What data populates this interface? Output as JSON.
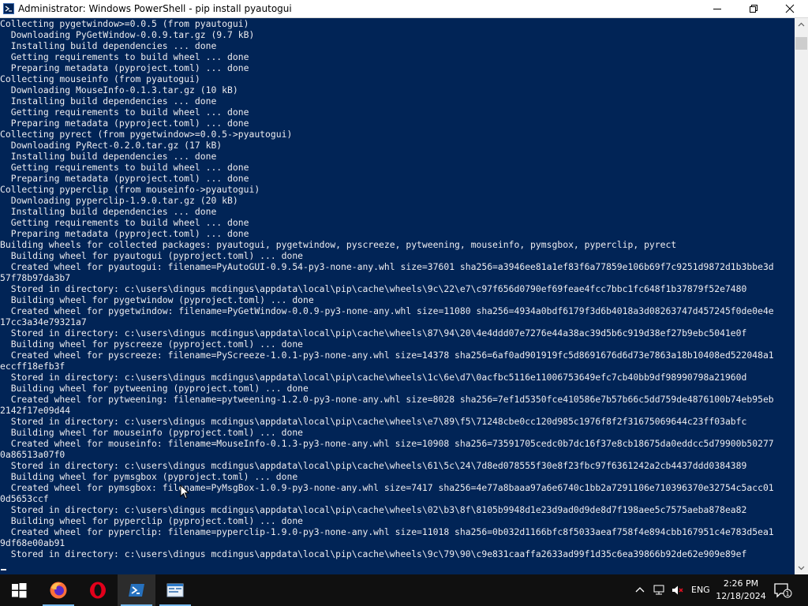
{
  "window": {
    "title": "Administrator: Windows PowerShell - pip  install pyautogui"
  },
  "console": {
    "lines": [
      "Collecting pygetwindow>=0.0.5 (from pyautogui)",
      "  Downloading PyGetWindow-0.0.9.tar.gz (9.7 kB)",
      "  Installing build dependencies ... done",
      "  Getting requirements to build wheel ... done",
      "  Preparing metadata (pyproject.toml) ... done",
      "Collecting mouseinfo (from pyautogui)",
      "  Downloading MouseInfo-0.1.3.tar.gz (10 kB)",
      "  Installing build dependencies ... done",
      "  Getting requirements to build wheel ... done",
      "  Preparing metadata (pyproject.toml) ... done",
      "Collecting pyrect (from pygetwindow>=0.0.5->pyautogui)",
      "  Downloading PyRect-0.2.0.tar.gz (17 kB)",
      "  Installing build dependencies ... done",
      "  Getting requirements to build wheel ... done",
      "  Preparing metadata (pyproject.toml) ... done",
      "Collecting pyperclip (from mouseinfo->pyautogui)",
      "  Downloading pyperclip-1.9.0.tar.gz (20 kB)",
      "  Installing build dependencies ... done",
      "  Getting requirements to build wheel ... done",
      "  Preparing metadata (pyproject.toml) ... done",
      "Building wheels for collected packages: pyautogui, pygetwindow, pyscreeze, pytweening, mouseinfo, pymsgbox, pyperclip, pyrect",
      "  Building wheel for pyautogui (pyproject.toml) ... done",
      "  Created wheel for pyautogui: filename=PyAutoGUI-0.9.54-py3-none-any.whl size=37601 sha256=a3946ee81a1ef83f6a77859e106b69f7c9251d9872d1b3bbe3d",
      "57f78b97da3b7",
      "  Stored in directory: c:\\users\\dingus mcdingus\\appdata\\local\\pip\\cache\\wheels\\9c\\22\\e7\\c97f656d0790ef69feae4fcc7bbc1fc648f1b37879f52e7480",
      "  Building wheel for pygetwindow (pyproject.toml) ... done",
      "  Created wheel for pygetwindow: filename=PyGetWindow-0.0.9-py3-none-any.whl size=11080 sha256=4934a0bdf6179f3d6b4018a3d08263747d457245f0de0e4e",
      "17cc3a34e79321a7",
      "  Stored in directory: c:\\users\\dingus mcdingus\\appdata\\local\\pip\\cache\\wheels\\87\\94\\20\\4e4ddd07e7276e44a38ac39d5b6c919d38ef27b9ebc5041e0f",
      "  Building wheel for pyscreeze (pyproject.toml) ... done",
      "  Created wheel for pyscreeze: filename=PyScreeze-1.0.1-py3-none-any.whl size=14378 sha256=6af0ad901919fc5d8691676d6d73e7863a18b10408ed522048a1",
      "eccff18efb3f",
      "  Stored in directory: c:\\users\\dingus mcdingus\\appdata\\local\\pip\\cache\\wheels\\1c\\6e\\d7\\0acfbc5116e11006753649efc7cb40bb9df98990798a21960d",
      "  Building wheel for pytweening (pyproject.toml) ... done",
      "  Created wheel for pytweening: filename=pytweening-1.2.0-py3-none-any.whl size=8028 sha256=7ef1d5350fce410586e7b57b66c5dd759de4876100b74eb95eb",
      "2142f17e09d44",
      "  Stored in directory: c:\\users\\dingus mcdingus\\appdata\\local\\pip\\cache\\wheels\\e7\\89\\f5\\71248cbe0cc120d985c1976f8f2f31675069644c23ff03abfc",
      "  Building wheel for mouseinfo (pyproject.toml) ... done",
      "  Created wheel for mouseinfo: filename=MouseInfo-0.1.3-py3-none-any.whl size=10908 sha256=73591705cedc0b7dc16f37e8cb18675da0eddcc5d79900b50277",
      "0a86513a07f0",
      "  Stored in directory: c:\\users\\dingus mcdingus\\appdata\\local\\pip\\cache\\wheels\\61\\5c\\24\\7d8ed078555f30e8f23fbc97f6361242a2cb4437ddd0384389",
      "  Building wheel for pymsgbox (pyproject.toml) ... done",
      "  Created wheel for pymsgbox: filename=PyMsgBox-1.0.9-py3-none-any.whl size=7417 sha256=4e77a8baaa97a6e6740c1bb2a7291106e710396370e32754c5acc01",
      "0d5653ccf",
      "  Stored in directory: c:\\users\\dingus mcdingus\\appdata\\local\\pip\\cache\\wheels\\02\\b3\\8f\\8105b9948d1e23d9ad0d9de8d7f198aee5c7575aeba878ea82",
      "  Building wheel for pyperclip (pyproject.toml) ... done",
      "  Created wheel for pyperclip: filename=pyperclip-1.9.0-py3-none-any.whl size=11018 sha256=0b032d1166bfc8f5033aeaf758f4e894cbb167951c4e783d5ea1",
      "9df68e00ab91",
      "  Stored in directory: c:\\users\\dingus mcdingus\\appdata\\local\\pip\\cache\\wheels\\9c\\79\\90\\c9e831caaffa2633ad99f1d35c6ea39866b92de62e909e89ef"
    ]
  },
  "colors": {
    "console_bg": "#012456",
    "console_fg": "#eeedf0",
    "taskbar_bg": "#101010",
    "accent": "#76b9ed"
  },
  "taskbar": {
    "items": [
      "windows-start-icon",
      "firefox-icon",
      "opera-icon",
      "powershell-icon",
      "app-window-icon"
    ],
    "tray": {
      "language": "ENG",
      "time": "2:26 PM",
      "date": "12/18/2024",
      "notification_count": "1"
    }
  }
}
